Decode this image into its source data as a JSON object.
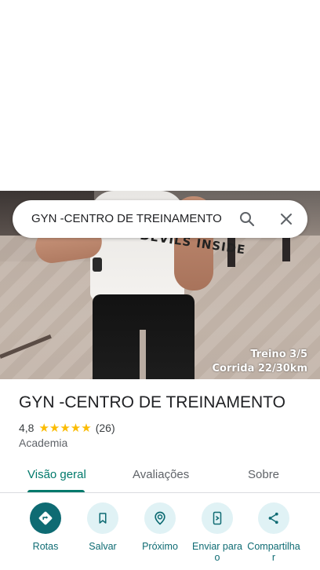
{
  "search": {
    "query": "GYN -CENTRO DE TREINAMENTO"
  },
  "photo": {
    "shirt_text": "DEVILS INSIDE",
    "overlay_line1": "Treino 3/5",
    "overlay_line2": "Corrida 22/30km"
  },
  "place": {
    "title": "GYN -CENTRO DE TREINAMENTO",
    "rating": "4,8",
    "stars": "★★★★★",
    "review_count": "(26)",
    "category": "Academia"
  },
  "tabs": [
    {
      "label": "Visão geral",
      "selected": true
    },
    {
      "label": "Avaliações",
      "selected": false
    },
    {
      "label": "Sobre",
      "selected": false
    }
  ],
  "actions": [
    {
      "label": "Rotas",
      "icon": "directions-icon"
    },
    {
      "label": "Salvar",
      "icon": "bookmark-icon"
    },
    {
      "label": "Próximo",
      "icon": "nearby-icon"
    },
    {
      "label": "Enviar para o",
      "icon": "send-to-phone-icon"
    },
    {
      "label": "Compartilhar",
      "icon": "share-icon"
    }
  ],
  "colors": {
    "accent": "#00796b",
    "action_primary": "#0e6b73",
    "action_bg": "#e0f2f5",
    "star": "#fbbc04"
  }
}
